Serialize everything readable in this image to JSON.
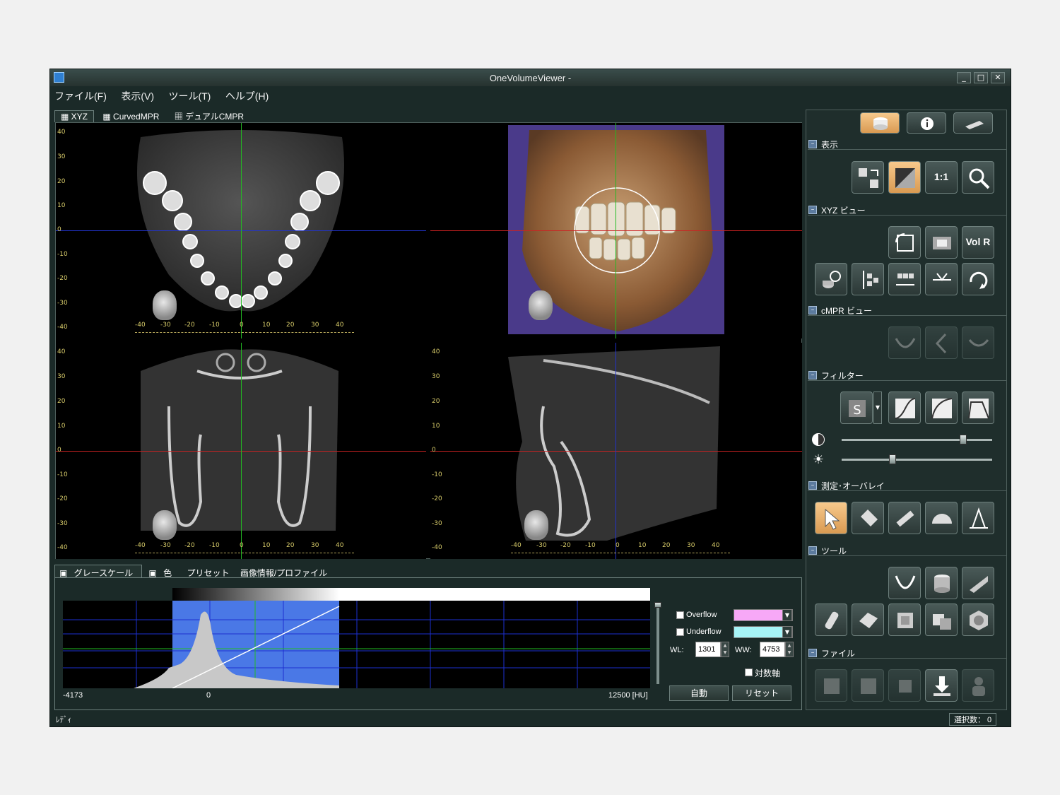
{
  "window": {
    "title": "OneVolumeViewer -",
    "min": "_",
    "max": "□",
    "close": "✕"
  },
  "menu": [
    "ファイル(F)",
    "表示(V)",
    "ツール(T)",
    "ヘルプ(H)"
  ],
  "view_tabs": [
    "XYZ",
    "CurvedMPR",
    "デュアルCMPR"
  ],
  "rulers": {
    "axial_v": [
      "40",
      "30",
      "20",
      "10",
      "0",
      "-10",
      "-20",
      "-30",
      "-40"
    ],
    "axial_h": [
      "-40",
      "-30",
      "-20",
      "-10",
      "0",
      "10",
      "20",
      "30",
      "40"
    ],
    "coronal_v": [
      "40",
      "30",
      "20",
      "10",
      "0",
      "-10",
      "-20",
      "-30",
      "-40"
    ],
    "coronal_h": [
      "-40",
      "-30",
      "-20",
      "-10",
      "0",
      "10",
      "20",
      "30",
      "40"
    ],
    "sagittal_v": [
      "40",
      "30",
      "20",
      "10",
      "0",
      "-10",
      "-20",
      "-30",
      "-40"
    ],
    "sagittal_h": [
      "-40",
      "-30",
      "-20",
      "-10",
      "0",
      "10",
      "20",
      "30",
      "40"
    ]
  },
  "bottom_tabs": [
    "グレースケール",
    "色",
    "プリセット",
    "画像情報/プロファイル"
  ],
  "histogram": {
    "min_label": "-4173",
    "zero_label": "0",
    "max_label": "12500 [HU]"
  },
  "controls": {
    "overflow": "Overflow",
    "underflow": "Underflow",
    "overflow_color": "#f7a8f7",
    "underflow_color": "#a6f4f7",
    "wl_label": "WL:",
    "wl_value": "1301",
    "ww_label": "WW:",
    "ww_value": "4753",
    "log_axis": "対数軸",
    "auto_button": "自動",
    "reset_button": "リセット"
  },
  "status": {
    "left": "ﾚﾃﾞｨ",
    "right": "選択数： 0"
  },
  "sections": {
    "display": "表示",
    "xyz_view": "XYZ ビュー",
    "cmpr_view": "cMPR ビュー",
    "filter": "フィルター",
    "measure": "測定･オーバレイ",
    "tools": "ツール",
    "file": "ファイル"
  },
  "buttons": {
    "ratio": "1:1",
    "volr": "Vol R"
  }
}
